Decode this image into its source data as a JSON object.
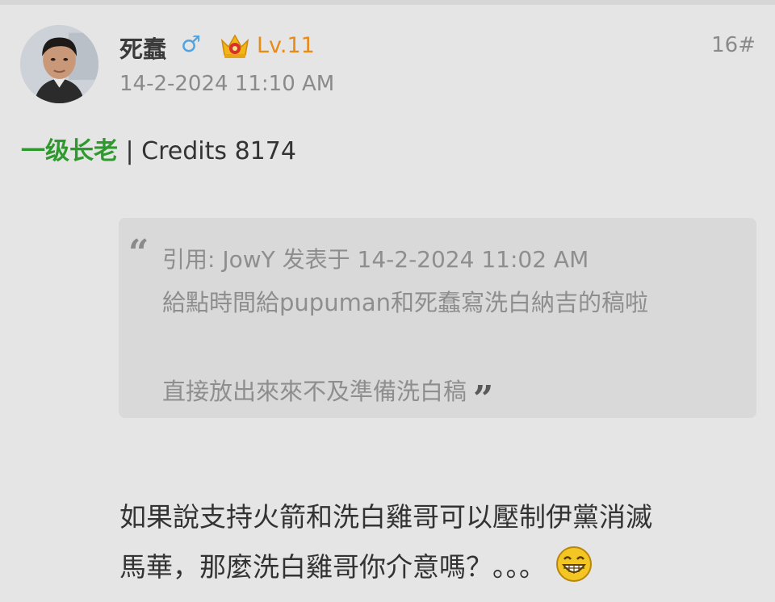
{
  "post": {
    "username": "死蠢",
    "gender_symbol": "♂",
    "level": "Lv.11",
    "floor": "16#",
    "timestamp": "14-2-2024 11:10 AM",
    "rank": "一级长老",
    "credits_text": " | Credits 8174",
    "quote": {
      "open_mark": "“",
      "header": "引用: JowY 发表于 14-2-2024 11:02 AM",
      "line1": "給點時間給pupuman和死蠢寫洗白納吉的稿啦",
      "line2": "直接放出來來不及準備洗白稿",
      "close_mark": "”"
    },
    "body": {
      "line1": "如果說支持火箭和洗白雞哥可以壓制伊黨消滅",
      "line2": "馬華，那麼洗白雞哥你介意嗎？。。。"
    }
  },
  "icons": {
    "avatar": "user-avatar",
    "crown": "crown-icon",
    "emoji": "laughing-emoji-icon"
  },
  "colors": {
    "background": "#e5e5e5",
    "quote_background": "#d9d9d9",
    "level": "#e88a18",
    "rank": "#2e9a2e",
    "gender": "#4fa3e0"
  }
}
